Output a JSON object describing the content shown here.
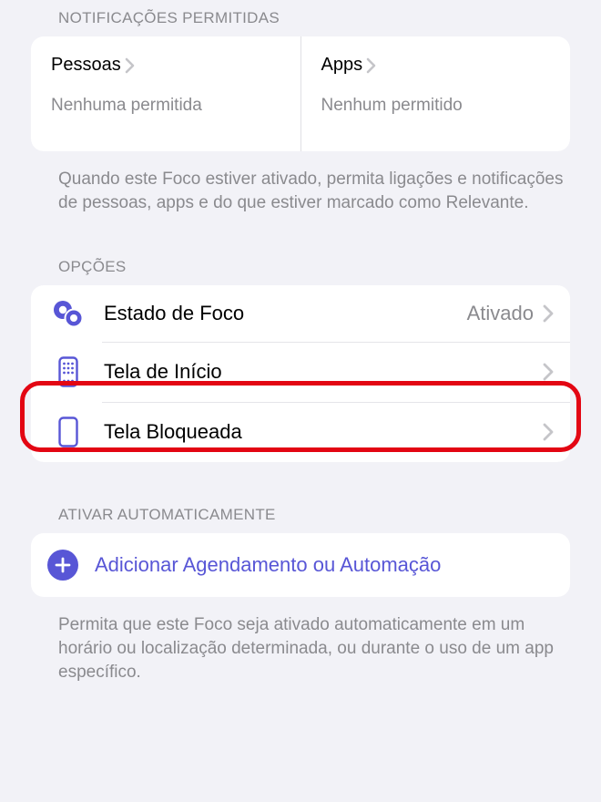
{
  "colors": {
    "accent": "#5856d6",
    "highlight": "#e30613"
  },
  "allowed": {
    "header": "NOTIFICAÇÕES PERMITIDAS",
    "people": {
      "title": "Pessoas",
      "subtitle": "Nenhuma permitida"
    },
    "apps": {
      "title": "Apps",
      "subtitle": "Nenhum permitido"
    },
    "footer": "Quando este Foco estiver ativado, permita ligações e notificações de pessoas, apps e do que estiver marcado como Relevante."
  },
  "options": {
    "header": "OPÇÕES",
    "rows": [
      {
        "label": "Estado de Foco",
        "value": "Ativado"
      },
      {
        "label": "Tela de Início",
        "value": ""
      },
      {
        "label": "Tela Bloqueada",
        "value": ""
      }
    ]
  },
  "auto": {
    "header": "ATIVAR AUTOMATICAMENTE",
    "add_label": "Adicionar Agendamento ou Automação",
    "footer": "Permita que este Foco seja ativado automaticamente em um horário ou localização determinada, ou durante o uso de um app específico."
  }
}
